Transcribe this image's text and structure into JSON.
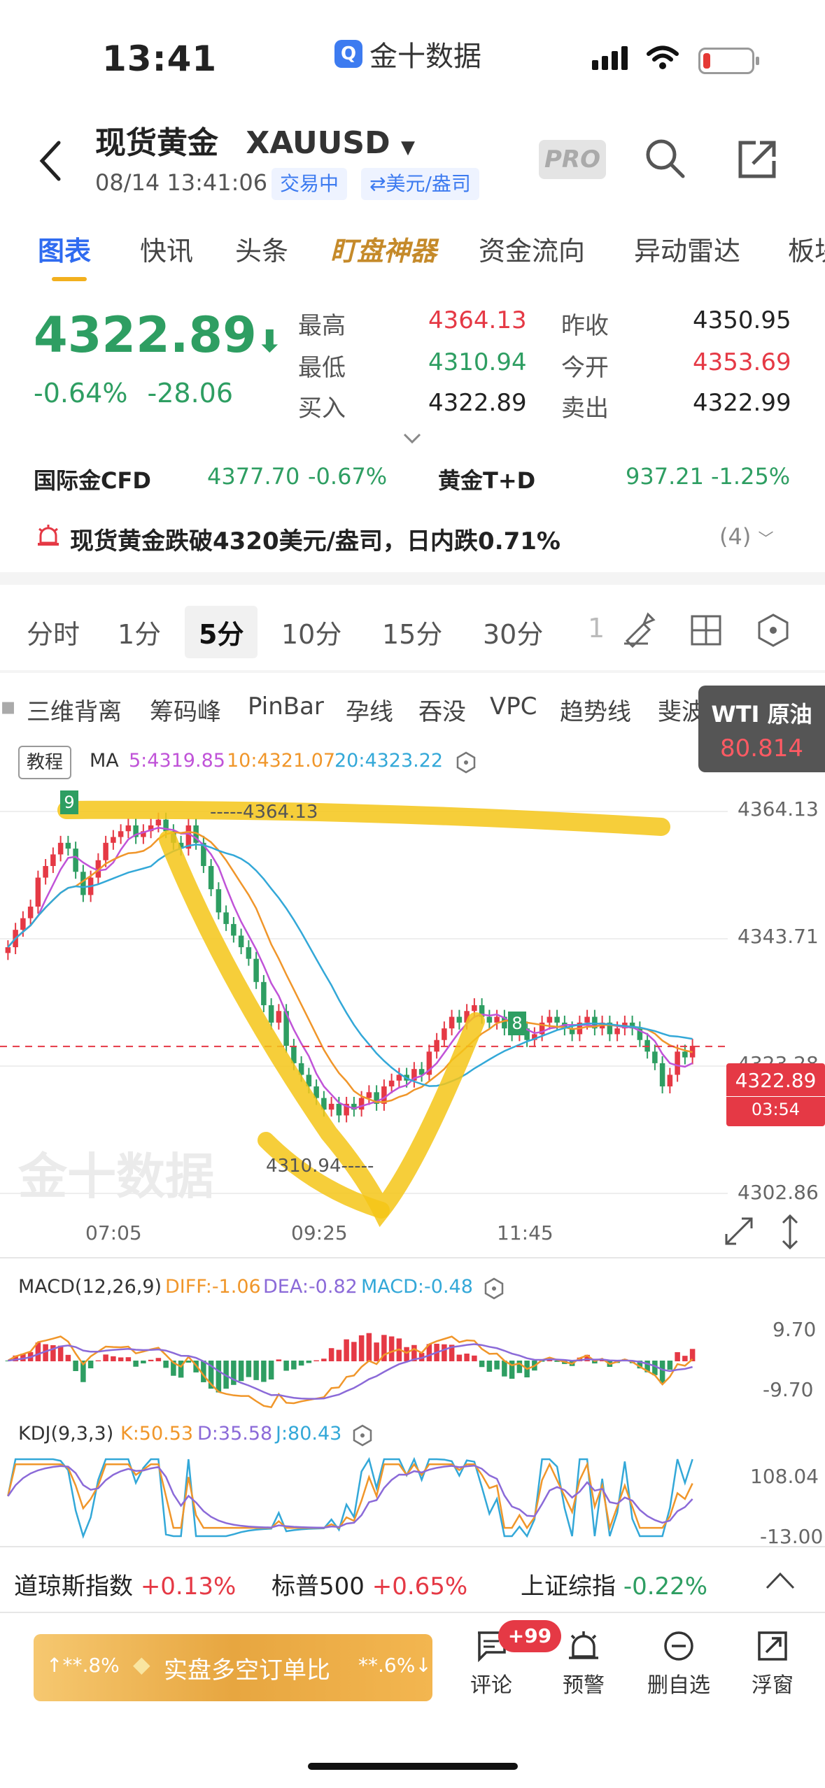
{
  "status_bar": {
    "time": "13:41",
    "app_name": "金十数据",
    "app_icon": "Q"
  },
  "header": {
    "title": "现货黄金",
    "symbol": "XAUUSD",
    "datetime": "08/14 13:41:06",
    "trading_status": "交易中",
    "unit": "⇄美元/盎司",
    "pro": "PRO"
  },
  "tabs": [
    "图表",
    "快讯",
    "头条",
    "盯盘神器",
    "资金流向",
    "异动雷达",
    "板块"
  ],
  "quote": {
    "price": "4322.89",
    "pct_change": "-0.64%",
    "abs_change": "-28.06",
    "high_label": "最高",
    "high": "4364.13",
    "low_label": "最低",
    "low": "4310.94",
    "bid_label": "买入",
    "bid": "4322.89",
    "prev_close_label": "昨收",
    "prev_close": "4350.95",
    "open_label": "今开",
    "open": "4353.69",
    "ask_label": "卖出",
    "ask": "4322.99"
  },
  "related": [
    {
      "name": "国际金CFD",
      "value": "4377.70",
      "change": "-0.67%"
    },
    {
      "name": "黄金T+D",
      "value": "937.21",
      "change": "-1.25%"
    }
  ],
  "alert": {
    "text": "现货黄金跌破4320美元/盎司，日内跌0.71%",
    "count": "(4)"
  },
  "periods": [
    "分时",
    "1分",
    "5分",
    "10分",
    "15分",
    "30分",
    "1"
  ],
  "indicators": [
    "三维背离",
    "筹码峰",
    "PinBar",
    "孕线",
    "吞没",
    "VPC",
    "趋势线",
    "斐波那契"
  ],
  "wti": {
    "label": "WTI 原油",
    "value": "80.814"
  },
  "chart_legend": {
    "tutorial": "教程",
    "ma": "MA",
    "ma5": "5:4319.85",
    "ma10": "10:4321.07",
    "ma20": "20:4323.22"
  },
  "chart_labels": {
    "high_mark": "4364.13",
    "low_mark": "4310.94",
    "countdown": "03:54",
    "current": "4322.89",
    "seq_top": "9",
    "seq_bottom": "8"
  },
  "chart_data": {
    "type": "candlestick",
    "y_ticks": [
      "4364.13",
      "4343.71",
      "4323.28",
      "4302.86"
    ],
    "x_ticks": [
      "07:05",
      "09:25",
      "11:45"
    ],
    "ylim": [
      4302.86,
      4364.13
    ],
    "close": [
      4340,
      4343,
      4345,
      4347,
      4352,
      4354,
      4356,
      4358,
      4357,
      4353,
      4349,
      4352,
      4355,
      4358,
      4359,
      4360,
      4361,
      4359,
      4360,
      4361,
      4362,
      4360,
      4358,
      4357,
      4361,
      4358,
      4354,
      4350,
      4346,
      4344,
      4342,
      4340,
      4338,
      4334,
      4330,
      4327,
      4329,
      4323,
      4320,
      4318,
      4316,
      4314,
      4312,
      4313,
      4311,
      4313,
      4312,
      4314,
      4315,
      4313,
      4316,
      4317,
      4318,
      4317,
      4319,
      4318,
      4322,
      4324,
      4326,
      4328,
      4327,
      4329,
      4330,
      4328,
      4327,
      4328,
      4326,
      4325,
      4326,
      4324,
      4325,
      4327,
      4328,
      4327,
      4326,
      4325,
      4327,
      4328,
      4326,
      4327,
      4325,
      4326,
      4327,
      4326,
      4324,
      4322,
      4320,
      4316,
      4318,
      4322,
      4321,
      4323
    ],
    "macd": {
      "label": "MACD(12,26,9)",
      "diff": "DIFF:-1.06",
      "dea": "DEA:-0.82",
      "macd": "MACD:-0.48",
      "ticks": [
        "9.70",
        "-9.70"
      ]
    },
    "kdj": {
      "label": "KDJ(9,3,3)",
      "k": "K:50.53",
      "d": "D:35.58",
      "j": "J:80.43",
      "ticks": [
        "108.04",
        "-13.00"
      ]
    }
  },
  "index_bar": [
    {
      "name": "道琼斯指数",
      "change": "+0.13%"
    },
    {
      "name": "标普500",
      "change": "+0.65%"
    },
    {
      "name": "上证综指",
      "change": "-0.22%"
    }
  ],
  "bottom": {
    "long": "↑**.8%",
    "title": "实盘多空订单比",
    "short": "**.6%↓",
    "badge": "+99",
    "comment": "评论",
    "alert": "预警",
    "remove": "删自选",
    "float": "浮窗"
  },
  "colors": {
    "up": "#e53945",
    "down": "#2e9e62",
    "accent": "#2f6bf0",
    "annotation": "#f5c518"
  }
}
